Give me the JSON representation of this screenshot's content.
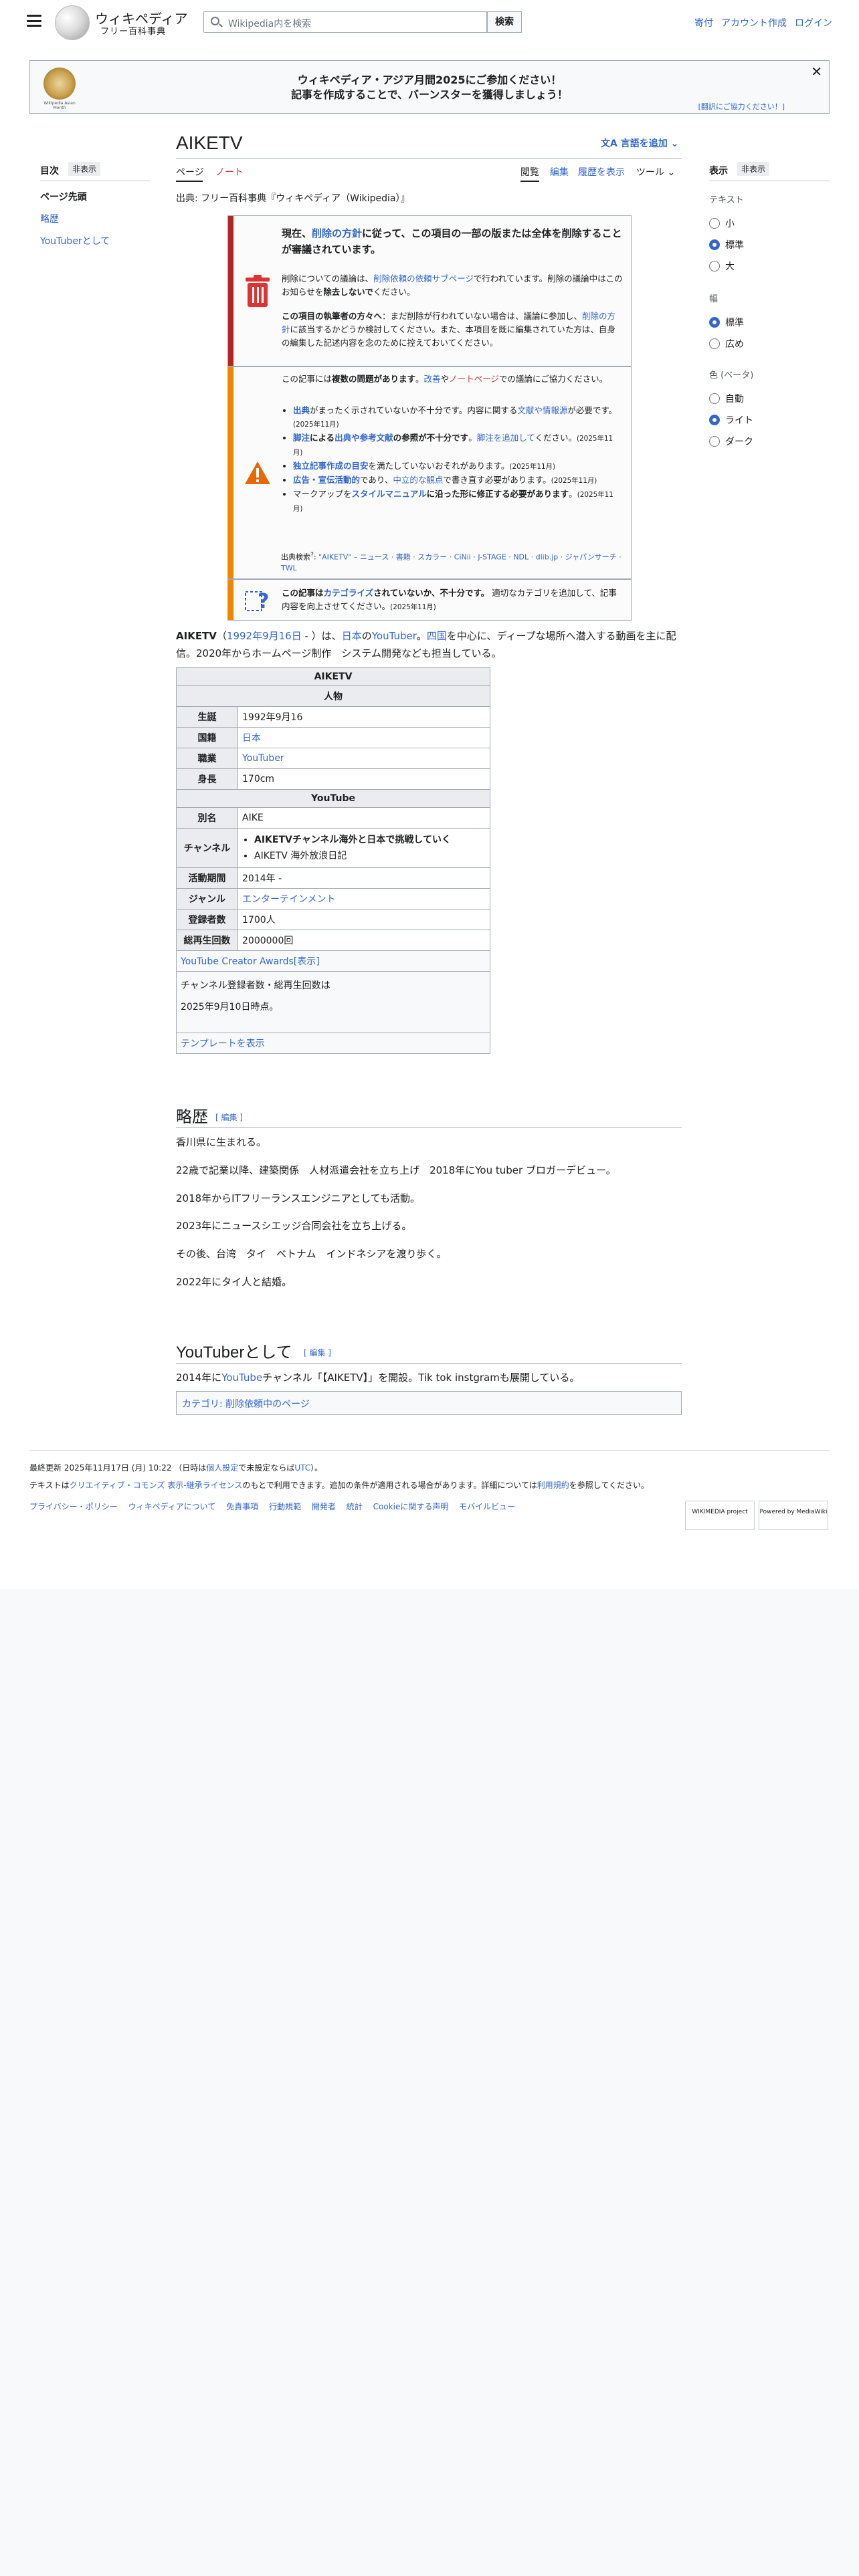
{
  "header": {
    "logo_title": "ウィキペディア",
    "logo_sub": "フリー百科事典",
    "search_placeholder": "Wikipedia内を検索",
    "search_button": "検索",
    "links": [
      "寄付",
      "アカウント作成",
      "ログイン"
    ]
  },
  "banner": {
    "line1": "ウィキペディア・アジア月間2025にご参加ください！",
    "line2": "記事を作成することで、バーンスターを獲得しましょう！",
    "help": "[翻訳にご協力ください！]",
    "close": "✕",
    "logo_caption": "Wikipedia Asian Month"
  },
  "toc": {
    "heading": "目次",
    "hide": "非表示",
    "items": [
      "ページ先頭",
      "略歴",
      "YouTuberとして"
    ]
  },
  "article": {
    "title": "AIKETV",
    "lang_button": "言語を追加",
    "tabs_left": [
      "ページ",
      "ノート"
    ],
    "tabs_right": [
      "閲覧",
      "編集",
      "履歴を表示",
      "ツール"
    ],
    "from": "出典: フリー百科事典『ウィキペディア（Wikipedia）』"
  },
  "appearance": {
    "heading": "表示",
    "hide": "非表示",
    "text_label": "テキスト",
    "text_opts": [
      "小",
      "標準",
      "大"
    ],
    "width_label": "幅",
    "width_opts": [
      "標準",
      "広め"
    ],
    "color_label": "色 (ベータ)",
    "color_opts": [
      "自動",
      "ライト",
      "ダーク"
    ]
  },
  "deletion": {
    "l1a": "現在、",
    "l1b": "削除の方針",
    "l1c": "に従って、この項目の一部の版または全体を削除することが審議されています。",
    "l2a": "削除についての議論は、",
    "l2b": "削除依頼の依頼サブページ",
    "l2c": "で行われています。削除の議論中はこのお知らせを",
    "l2d": "除去しないで",
    "l2e": "ください。",
    "l3a": "この項目の執筆者の方々へ",
    "l3b": "：まだ削除が行われていない場合は、議論に参加し、",
    "l3c": "削除の方針",
    "l3d": "に該当するかどうか検討してください。また、本項目を既に編集されていた方は、自身の編集した記述内容を念のために控えておいてください。"
  },
  "issues": {
    "intro_a": "この記事には",
    "intro_b": "複数の問題があります",
    "intro_c": "。",
    "intro_d": "改善",
    "intro_e": "や",
    "intro_f": "ノートページ",
    "intro_g": "での議論にご協力ください。",
    "i1a": "出典",
    "i1b": "がまったく示されていないか不十分です。内容に関する",
    "i1c": "文献や情報源",
    "i1d": "が必要です。",
    "i1e": "(2025年11月)",
    "i2a": "脚注",
    "i2b": "による",
    "i2c": "出典や参考文献",
    "i2d": "の参照が不十分です",
    "i2e": "。",
    "i2f": "脚注を追加して",
    "i2g": "ください。",
    "i2h": "(2025年11月)",
    "i3a": "独立記事作成の目安",
    "i3b": "を満たしていないおそれがあります。",
    "i3c": "(2025年11月)",
    "i4a": "広告・宣伝活動的",
    "i4b": "であり、",
    "i4c": "中立的な観点",
    "i4d": "で書き直す必要があります。",
    "i4e": "(2025年11月)",
    "i5a": "マークアップを",
    "i5b": "スタイルマニュアル",
    "i5c": "に沿った形に修正する必要があります",
    "i5d": "。",
    "i5e": "(2025年11月)",
    "src_label": "出典検索",
    "src_links": "\"AIKETV\" – ニュース · 書籍 · スカラー · CiNii · J-STAGE · NDL · dlib.jp · ジャパンサーチ · TWL"
  },
  "category": {
    "a": "この記事は",
    "b": "カテゴライズ",
    "c": "されていないか、不十分です。",
    "d": "適切なカテゴリを追加して、記事内容を向上させてください。",
    "e": "(2025年11月)"
  },
  "lead": {
    "a": "AIKETV",
    "b": "（",
    "c": "1992年9月16日",
    "d": " - ）は、",
    "e": "日本",
    "f": "の",
    "g": "YouTuber",
    "h": "。",
    "i": "四国",
    "j": "を中心に、ディープな場所へ潜入する動画を主に配信。2020年からホームページ制作　システム開発なども担当している。"
  },
  "infobox": {
    "title": "AIKETV",
    "person": "人物",
    "rows": [
      {
        "k": "生誕",
        "v": "1992年9月16"
      },
      {
        "k": "国籍",
        "v": "日本"
      },
      {
        "k": "職業",
        "v": "YouTuber"
      },
      {
        "k": "身長",
        "v": "170cm"
      }
    ],
    "yt": "YouTube",
    "alias_k": "別名",
    "alias_v": "AIKE",
    "ch_k": "チャンネル",
    "ch_1": "AIKETVチャンネル海外と日本で挑戦していく",
    "ch_2": "AIKETV 海外放浪日記",
    "rows2": [
      {
        "k": "活動期間",
        "v": "2014年 -"
      },
      {
        "k": "ジャンル",
        "v": "エンターテインメント"
      },
      {
        "k": "登録者数",
        "v": "1700人"
      },
      {
        "k": "総再生回数",
        "v": "2000000回"
      }
    ],
    "awards": "YouTube Creator Awards",
    "awards_show": "[表示]",
    "note1": "チャンネル登録者数・総再生回数は",
    "note2": "2025年9月10日時点。",
    "template": "テンプレートを表示"
  },
  "bio": {
    "heading": "略歴",
    "edit": "[ 編集 ]",
    "p": [
      "香川県に生まれる。",
      "22歳で記業以降、建築関係　人材派遣会社を立ち上げ　2018年にYou tuber ブロガーデビュー。",
      "2018年からITフリーランスエンジニアとしても活動。",
      "2023年にニュースシエッジ合同会社を立ち上げる。",
      "その後、台湾　タイ　ベトナム　インドネシアを渡り歩く。",
      "2022年にタイ人と結婚。"
    ]
  },
  "yts": {
    "heading": "YouTuberとして",
    "edit": "[ 編集 ]",
    "a": "2014年に",
    "b": "YouTube",
    "c": "チャンネル「【AIKETV】」を開設。Tik tok instgramも展開している。"
  },
  "cats": {
    "label": "カテゴリ",
    "sep": ": ",
    "item": "削除依頼中のページ"
  },
  "footer": {
    "line1a": "最終更新 2025年11月17日 (月) 10:22 （日時は",
    "line1b": "個人設定",
    "line1c": "で未設定ならば",
    "line1d": "UTC",
    "line1e": "）。",
    "line2a": "テキストは",
    "line2b": "クリエイティブ・コモンズ 表示-継承ライセンス",
    "line2c": "のもとで利用できます。追加の条件が適用される場合があります。詳細については",
    "line2d": "利用規約",
    "line2e": "を参照してください。",
    "links": [
      "プライバシー・ポリシー",
      "ウィキペディアについて",
      "免責事項",
      "行動規範",
      "開発者",
      "統計",
      "Cookieに関する声明",
      "モバイルビュー"
    ],
    "badge1": "WIKIMEDIA project",
    "badge2": "Powered by MediaWiki"
  }
}
